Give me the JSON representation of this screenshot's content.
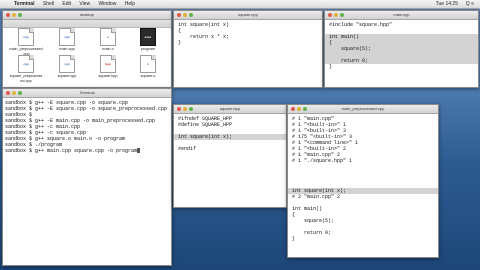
{
  "menubar": {
    "apple": "",
    "app": "Terminal",
    "items": [
      "Shell",
      "Edit",
      "View",
      "Window",
      "Help"
    ],
    "clock": "Tue 14:25",
    "status": "Q ≡"
  },
  "finder": {
    "title": "desktop",
    "files": [
      {
        "name": "main_preprocessed.cpp",
        "tag": "cpp"
      },
      {
        "name": "main.cpp",
        "tag": "cpp"
      },
      {
        "name": "main.o",
        "tag": "o"
      },
      {
        "name": "program",
        "tag": "exec"
      },
      {
        "name": "square_preprocessed.cpp",
        "tag": "cpp"
      },
      {
        "name": "square.cpp",
        "tag": "cpp"
      },
      {
        "name": "square.hpp",
        "tag": "hpp"
      },
      {
        "name": "square.o",
        "tag": "o"
      }
    ]
  },
  "square_cpp": {
    "title": "square.cpp",
    "lines": [
      "int square(int x)",
      "{",
      "    return x * x;",
      "}"
    ]
  },
  "main_cpp": {
    "title": "main.cpp",
    "lines": [
      "#include \"square.hpp\"",
      "",
      "int main()",
      "{",
      "    square(5);",
      "",
      "    return 0;",
      "}"
    ]
  },
  "terminal": {
    "title": "Terminal",
    "lines": [
      "sandbox $ g++ -E square.cpp -o square.cpp",
      "sandbox $ g++ -E square.cpp -o square_preprocessed.cpp",
      "sandbox $ ",
      "sandbox $ g++ -E main.cpp -o main_preprocessed.cpp",
      "sandbox $ g++ -c main.cpp",
      "sandbox $ g++ -c square.cpp",
      "sandbox $ g++ square.o main.o -o program",
      "sandbox $ ./program",
      "sandbox $ g++ main.cpp square.cpp -o program"
    ]
  },
  "square_hpp": {
    "title": "square.hpp",
    "lines": [
      "#ifndef SQUARE_HPP",
      "#define SQUARE_HPP",
      "",
      "int square(int x);",
      "",
      "#endif"
    ]
  },
  "main_pre": {
    "title": "main_preprocessed.cpp",
    "lines": [
      "# 1 \"main.cpp\"",
      "# 1 \"<built-in>\" 1",
      "# 1 \"<built-in>\" 3",
      "# 175 \"<built-in>\" 3",
      "# 1 \"<command line>\" 1",
      "# 1 \"<built-in>\" 2",
      "# 1 \"main.cpp\" 2",
      "# 1 \"./square.hpp\" 1",
      "",
      "",
      "",
      "",
      "int square(int x);",
      "# 2 \"main.cpp\" 2",
      "",
      "int main()",
      "{",
      "    square(5);",
      "",
      "    return 0;",
      "}"
    ]
  }
}
